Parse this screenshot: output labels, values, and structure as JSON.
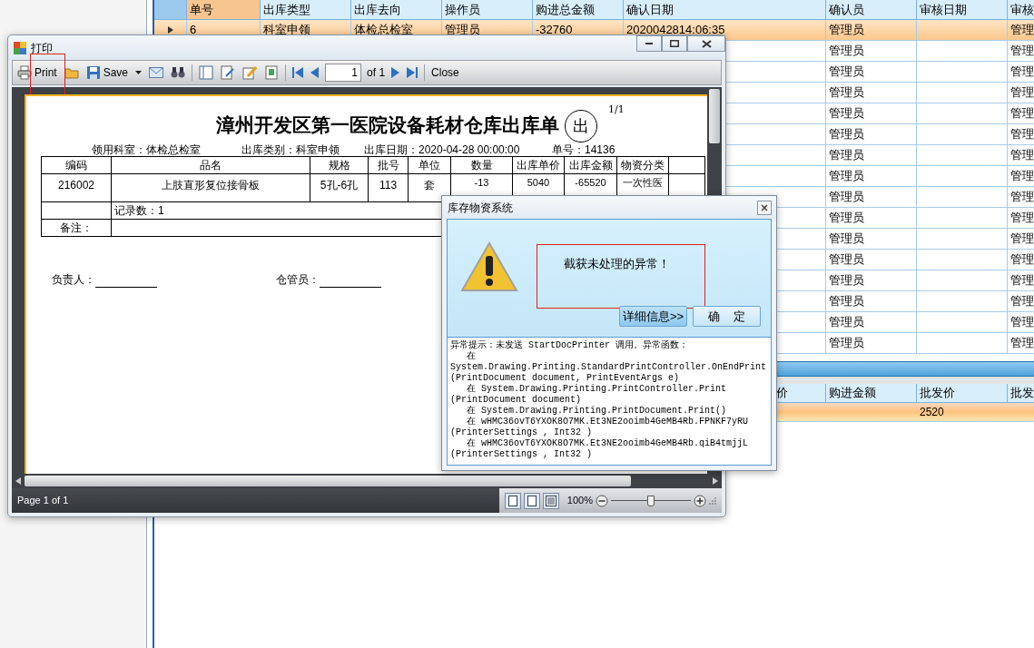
{
  "main_grid": {
    "columns": [
      "单号",
      "出库类型",
      "出库去向",
      "操作员",
      "购进总金额",
      "确认日期",
      "确认员",
      "审核日期",
      "审核"
    ],
    "rows": [
      {
        "selected": true,
        "cells": [
          "6",
          "科室申领",
          "体检总检室",
          "管理员",
          "-32760",
          "2020042814:06:35",
          "管理员",
          null,
          "管理"
        ]
      },
      {
        "selected": false,
        "cells": [
          null,
          null,
          null,
          null,
          null,
          null,
          "管理员",
          null,
          "管理"
        ]
      },
      {
        "selected": false,
        "cells": [
          null,
          null,
          null,
          null,
          null,
          null,
          "管理员",
          null,
          "管理"
        ]
      },
      {
        "selected": false,
        "cells": [
          null,
          null,
          null,
          null,
          null,
          null,
          "管理员",
          null,
          "管理"
        ]
      },
      {
        "selected": false,
        "cells": [
          null,
          null,
          null,
          null,
          null,
          null,
          "管理员",
          null,
          "管理"
        ]
      },
      {
        "selected": false,
        "cells": [
          null,
          null,
          null,
          null,
          null,
          null,
          "管理员",
          null,
          "管理"
        ]
      },
      {
        "selected": false,
        "cells": [
          null,
          null,
          null,
          null,
          null,
          null,
          "管理员",
          null,
          "管理"
        ]
      },
      {
        "selected": false,
        "cells": [
          null,
          null,
          null,
          null,
          null,
          null,
          "管理员",
          null,
          "管理"
        ]
      },
      {
        "selected": false,
        "cells": [
          null,
          null,
          null,
          null,
          null,
          null,
          "管理员",
          null,
          "管理"
        ]
      },
      {
        "selected": false,
        "cells": [
          null,
          null,
          null,
          null,
          null,
          null,
          "管理员",
          null,
          "管理"
        ]
      },
      {
        "selected": false,
        "cells": [
          null,
          null,
          null,
          null,
          null,
          null,
          "管理员",
          null,
          "管理"
        ]
      },
      {
        "selected": false,
        "cells": [
          null,
          null,
          null,
          null,
          null,
          null,
          "管理员",
          null,
          "管理"
        ]
      },
      {
        "selected": false,
        "cells": [
          null,
          null,
          null,
          null,
          null,
          null,
          "管理员",
          null,
          "管理"
        ]
      },
      {
        "selected": false,
        "cells": [
          null,
          null,
          null,
          null,
          null,
          null,
          "管理员",
          null,
          "管理"
        ]
      },
      {
        "selected": false,
        "cells": [
          null,
          null,
          null,
          null,
          null,
          null,
          "管理员",
          null,
          "管理"
        ]
      },
      {
        "selected": false,
        "cells": [
          null,
          null,
          null,
          null,
          null,
          null,
          "管理员",
          null,
          "管理"
        ]
      }
    ]
  },
  "detail_grid": {
    "columns": [
      "价",
      "购进金额",
      "批发价",
      "批发"
    ],
    "rows": [
      {
        "selected": true,
        "cells": [
          null,
          null,
          "2520",
          null
        ]
      }
    ]
  },
  "print_window": {
    "title": "打印",
    "toolbar": {
      "print": "Print",
      "save": "Save",
      "page_value": "1",
      "page_total": "of 1",
      "close": "Close"
    },
    "report": {
      "title": "漳州开发区第一医院设备耗材仓库出库单",
      "stamp": "出",
      "page": "1/1",
      "info": [
        "领用科室：体检总检室",
        "出库类别：科室申领",
        "出库日期：2020-04-28 00:00:00",
        "单号：14136"
      ],
      "columns": [
        "编码",
        "品名",
        "规格",
        "批号",
        "单位",
        "数量",
        "出库单价",
        "出库金额",
        "物资分类"
      ],
      "rows": [
        [
          "216002",
          "上肢直形复位接骨板",
          "5孔-6孔",
          "113",
          "套",
          "-13",
          "5040",
          "-65520",
          "一次性医"
        ]
      ],
      "record_count": "记录数：1",
      "remarks_label": "备注：",
      "signatures": [
        "负责人：",
        "仓管员："
      ]
    },
    "status": {
      "page": "Page 1 of 1",
      "zoom": "100%",
      "zoom_slider": {
        "level": 0.5
      }
    }
  },
  "dialog": {
    "title": "库存物资系统",
    "message": "截获未处理的异常！",
    "buttons": [
      "详细信息>>",
      "确    定"
    ],
    "details": [
      "异常提示：未发送 StartDocPrinter 调用。异常函数：",
      "   在",
      "System.Drawing.Printing.StandardPrintController.OnEndPrint",
      "(PrintDocument document, PrintEventArgs e)",
      "   在 System.Drawing.Printing.PrintController.Print",
      "(PrintDocument document)",
      "   在 System.Drawing.Printing.PrintDocument.Print()",
      "   在 wHMC36ovT6YXOK8O7MK.Et3NE2ooimb4GeMB4Rb.FPNKF7yRU",
      "(PrinterSettings , Int32 )",
      "   在 wHMC36ovT6YXOK8O7MK.Et3NE2ooimb4GeMB4Rb.qiB4tmjjL",
      "(PrinterSettings , Int32 )"
    ]
  }
}
